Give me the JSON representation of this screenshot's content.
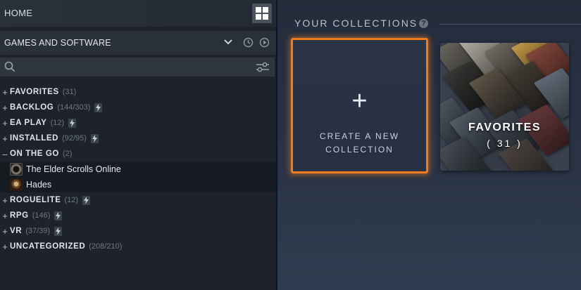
{
  "sidebar": {
    "home_label": "HOME",
    "grid_view_icon": "grid-view-icon",
    "filter": {
      "label": "GAMES AND SOFTWARE",
      "dropdown_icon": "chevron-down-icon",
      "recent_icon": "clock-icon",
      "play_icon": "play-circle-icon"
    },
    "search": {
      "value": "",
      "placeholder": "",
      "icon": "search-icon",
      "advanced_icon": "filter-sliders-icon"
    },
    "collections": [
      {
        "toggle": "+",
        "name": "FAVORITES",
        "count": "(31)",
        "dynamic": false
      },
      {
        "toggle": "+",
        "name": "BACKLOG",
        "count": "(144/303)",
        "dynamic": true
      },
      {
        "toggle": "+",
        "name": "EA PLAY",
        "count": "(12)",
        "dynamic": true
      },
      {
        "toggle": "+",
        "name": "INSTALLED",
        "count": "(92/95)",
        "dynamic": true
      },
      {
        "toggle": "–",
        "name": "ON THE GO",
        "count": "(2)",
        "dynamic": false,
        "games": [
          {
            "name": "The Elder Scrolls Online",
            "icon": "elder-scrolls-online-thumb"
          },
          {
            "name": "Hades",
            "icon": "hades-thumb"
          }
        ]
      },
      {
        "toggle": "+",
        "name": "ROGUELITE",
        "count": "(12)",
        "dynamic": true
      },
      {
        "toggle": "+",
        "name": "RPG",
        "count": "(146)",
        "dynamic": true
      },
      {
        "toggle": "+",
        "name": "VR",
        "count": "(37/39)",
        "dynamic": true
      },
      {
        "toggle": "+",
        "name": "UNCATEGORIZED",
        "count": "(208/210)",
        "dynamic": false
      }
    ]
  },
  "main": {
    "title": "YOUR COLLECTIONS",
    "help_icon": "?",
    "create_card": {
      "plus": "+",
      "line1": "CREATE A NEW",
      "line2": "COLLECTION"
    },
    "favorites_card": {
      "name": "FAVORITES",
      "count": "( 31 )"
    }
  },
  "colors": {
    "accent_orange": "#f27a1f",
    "sidebar_bg": "#1e232b",
    "main_bg": "#2a3446",
    "text_primary": "#dfe5ec",
    "text_muted": "#6d7784"
  }
}
